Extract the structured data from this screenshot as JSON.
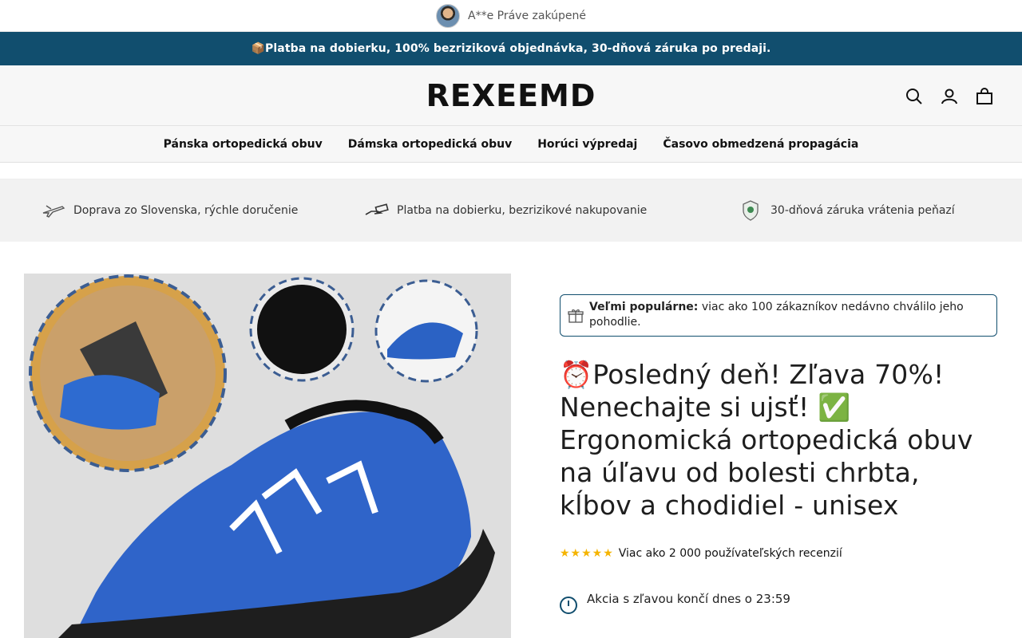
{
  "topbar": {
    "text": "A**e Práve zakúpené"
  },
  "promo": {
    "text": "📦Platba na dobierku, 100% bezriziková objednávka, 30-dňová záruka po predaji."
  },
  "header": {
    "logo": "REXEEMD"
  },
  "nav": {
    "items": [
      "Pánska ortopedická obuv",
      "Dámska ortopedická obuv",
      "Horúci výpredaj",
      "Časovo obmedzená propagácia"
    ]
  },
  "features": [
    {
      "icon": "airplane-icon",
      "text": "Doprava zo Slovenska, rýchle doručenie"
    },
    {
      "icon": "hand-cash-icon",
      "text": "Platba na dobierku, bezrizikové nakupovanie"
    },
    {
      "icon": "shield-badge-icon",
      "text": "30-dňová záruka vrátenia peňazí"
    }
  ],
  "product": {
    "popular_bold": "Veľmi populárne:",
    "popular_text": " viac ako 100 zákazníkov nedávno chválilo jeho pohodlie.",
    "title": "⏰Posledný deň! Zľava 70%! Nenechajte si ujsť! ✅ Ergonomická ortopedická obuv na úľavu od bolesti chrbta, kĺbov a chodidiel - unisex",
    "rating_stars": "★★★★★",
    "rating": 4.5,
    "reviews_text": "Viac ako 2 000 používateľských recenzií",
    "deal_text": "Akcia s zľavou končí dnes o 23:59"
  },
  "colors": {
    "brand": "#114e6e",
    "accent": "#1a73c9",
    "star": "#f5b400"
  }
}
